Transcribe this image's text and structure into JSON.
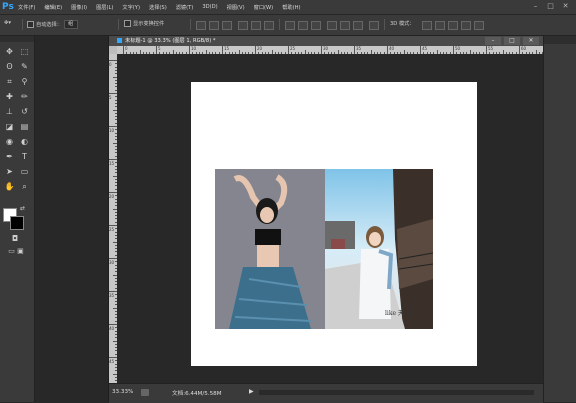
{
  "app": {
    "logo": "Ps"
  },
  "menu": {
    "items": [
      "文件(F)",
      "编辑(E)",
      "图像(I)",
      "图层(L)",
      "文字(Y)",
      "选择(S)",
      "滤镜(T)",
      "3D(D)",
      "视图(V)",
      "窗口(W)",
      "帮助(H)"
    ]
  },
  "window_controls": {
    "minimize": "–",
    "maximize": "□",
    "close": "✕"
  },
  "options": {
    "auto_select_label": "自动选择：",
    "auto_select_value": "组",
    "transform_label": "显示变换控件",
    "mode_3d_label": "3D 模式："
  },
  "document": {
    "tab_title": "未标题-1 @ 33.3% (图层 1, RGB/8) *",
    "zoom": "33.33%",
    "doc_info": "文档:6.44M/5.58M",
    "arrow": "▶",
    "ruler_top_labels": [
      "0",
      "5",
      "10",
      "15",
      "20",
      "25",
      "30",
      "35",
      "40",
      "45",
      "50",
      "55",
      "60"
    ],
    "ruler_left_labels": [
      "0",
      "5",
      "10",
      "15",
      "20",
      "25",
      "30",
      "35",
      "40",
      "45"
    ],
    "photo_signature": "like 天·美"
  },
  "tools": {
    "icons": [
      "move-icon",
      "marquee-icon",
      "lasso-icon",
      "quick-select-icon",
      "crop-icon",
      "eyedropper-icon",
      "healing-brush-icon",
      "brush-icon",
      "clone-stamp-icon",
      "history-brush-icon",
      "eraser-icon",
      "gradient-icon",
      "blur-icon",
      "dodge-icon",
      "pen-icon",
      "type-icon",
      "path-select-icon",
      "shape-icon",
      "hand-icon",
      "zoom-icon"
    ],
    "glyphs": [
      "✥",
      "⬚",
      "ʘ",
      "✎",
      "⌗",
      "⚲",
      "✚",
      "✏",
      "⊥",
      "↺",
      "◪",
      "▤",
      "◉",
      "◐",
      "✒",
      "T",
      "➤",
      "▭",
      "✋",
      "⌕"
    ]
  }
}
